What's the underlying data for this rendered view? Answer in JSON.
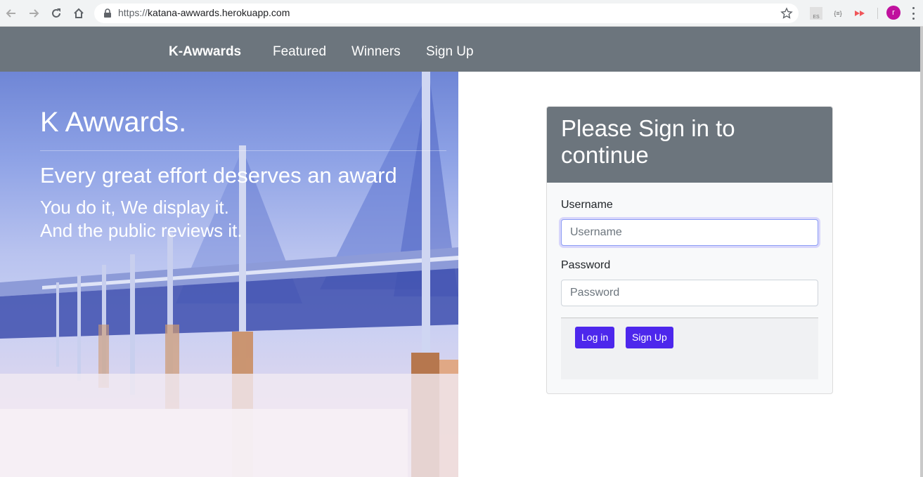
{
  "browser": {
    "url_scheme": "https://",
    "url_host": "katana-awwards.herokuapp.com",
    "extensions": [
      "ES",
      "{≡}"
    ],
    "profile_initial": "r"
  },
  "navbar": {
    "brand": "K-Awwards",
    "links": [
      "Featured",
      "Winners",
      "Sign Up"
    ]
  },
  "hero": {
    "title": "K Awwards.",
    "lead": "Every great effort deserves an award",
    "line1": "You do it, We display it.",
    "line2": "And the public reviews it."
  },
  "signin": {
    "title": "Please Sign in to continue",
    "username_label": "Username",
    "username_placeholder": "Username",
    "password_label": "Password",
    "password_placeholder": "Password",
    "login_button": "Log in",
    "signup_button": "Sign Up"
  }
}
